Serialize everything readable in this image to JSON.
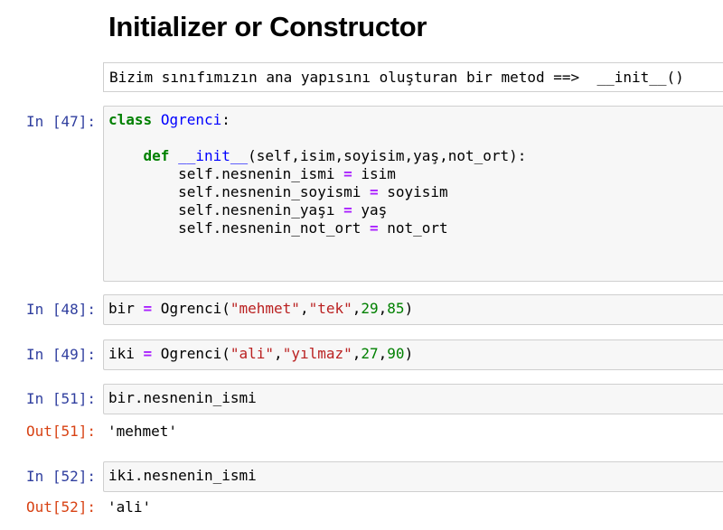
{
  "heading": "Initializer or Constructor",
  "markdown": {
    "text": "Bizim sınıfımızın ana yapısını oluşturan bir metod ==>  __init__()"
  },
  "cells": [
    {
      "prompt": "In [47]:",
      "lines": [
        [
          [
            "kw",
            "class"
          ],
          [
            "",
            " "
          ],
          [
            "cls",
            "Ogrenci"
          ],
          [
            "",
            ":"
          ]
        ],
        [],
        [
          [
            "",
            "    "
          ],
          [
            "kw",
            "def"
          ],
          [
            "",
            " "
          ],
          [
            "fn",
            "__init__"
          ],
          [
            "",
            "(self,isim,soyisim,yaş,not_ort):"
          ]
        ],
        [
          [
            "",
            "        self.nesnenin_ismi "
          ],
          [
            "op",
            "="
          ],
          [
            "",
            " isim"
          ]
        ],
        [
          [
            "",
            "        self.nesnenin_soyismi "
          ],
          [
            "op",
            "="
          ],
          [
            "",
            " soyisim"
          ]
        ],
        [
          [
            "",
            "        self.nesnenin_yaşı "
          ],
          [
            "op",
            "="
          ],
          [
            "",
            " yaş"
          ]
        ],
        [
          [
            "",
            "        self.nesnenin_not_ort "
          ],
          [
            "op",
            "="
          ],
          [
            "",
            " not_ort"
          ]
        ]
      ]
    },
    {
      "prompt": "In [48]:",
      "lines": [
        [
          [
            "",
            "bir "
          ],
          [
            "op",
            "="
          ],
          [
            "",
            " Ogrenci("
          ],
          [
            "str",
            "\"mehmet\""
          ],
          [
            "",
            ","
          ],
          [
            "str",
            "\"tek\""
          ],
          [
            "",
            ","
          ],
          [
            "num",
            "29"
          ],
          [
            "",
            ","
          ],
          [
            "num",
            "85"
          ],
          [
            "",
            ")"
          ]
        ]
      ]
    },
    {
      "prompt": "In [49]:",
      "lines": [
        [
          [
            "",
            "iki "
          ],
          [
            "op",
            "="
          ],
          [
            "",
            " Ogrenci("
          ],
          [
            "str",
            "\"ali\""
          ],
          [
            "",
            ","
          ],
          [
            "str",
            "\"yılmaz\""
          ],
          [
            "",
            ","
          ],
          [
            "num",
            "27"
          ],
          [
            "",
            ","
          ],
          [
            "num",
            "90"
          ],
          [
            "",
            ")"
          ]
        ]
      ]
    },
    {
      "prompt": "In [51]:",
      "lines": [
        [
          [
            "",
            "bir.nesnenin_ismi"
          ]
        ]
      ],
      "out_prompt": "Out[51]:",
      "output": "'mehmet'"
    },
    {
      "prompt": "In [52]:",
      "lines": [
        [
          [
            "",
            "iki.nesnenin_ismi"
          ]
        ]
      ],
      "out_prompt": "Out[52]:",
      "output": "'ali'"
    }
  ]
}
